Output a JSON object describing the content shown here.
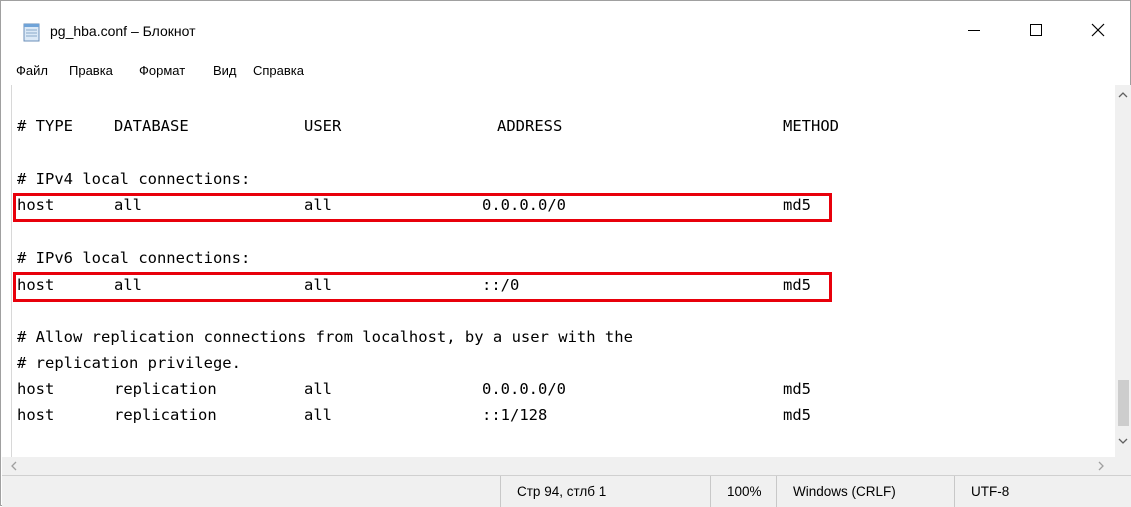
{
  "window": {
    "title": "pg_hba.conf – Блокнот"
  },
  "menu": [
    "Файл",
    "Правка",
    "Формат",
    "Вид",
    "Справка"
  ],
  "editor": {
    "header": [
      "# TYPE",
      "DATABASE",
      "USER",
      "ADDRESS",
      "METHOD"
    ],
    "ipv4_comment": "# IPv4 local connections:",
    "ipv4_row": [
      "host",
      "all",
      "all",
      "0.0.0.0/0",
      "md5"
    ],
    "ipv6_comment": "# IPv6 local connections:",
    "ipv6_row": [
      "host",
      "all",
      "all",
      "::/0",
      "md5"
    ],
    "repl_comment_1": "# Allow replication connections from localhost, by a user with the",
    "repl_comment_2": "# replication privilege.",
    "repl_row_1": [
      "host",
      "replication",
      "all",
      "0.0.0.0/0",
      "md5"
    ],
    "repl_row_2": [
      "host",
      "replication",
      "all",
      "::1/128",
      "md5"
    ]
  },
  "status": {
    "position": "Стр 94, стлб 1",
    "zoom": "100%",
    "line_endings": "Windows (CRLF)",
    "encoding": "UTF-8"
  },
  "colors": {
    "highlight": "#e8000b"
  },
  "icons": {
    "app": "notepad-icon",
    "minimize": "minimize-icon",
    "maximize": "maximize-icon",
    "close": "close-icon"
  }
}
